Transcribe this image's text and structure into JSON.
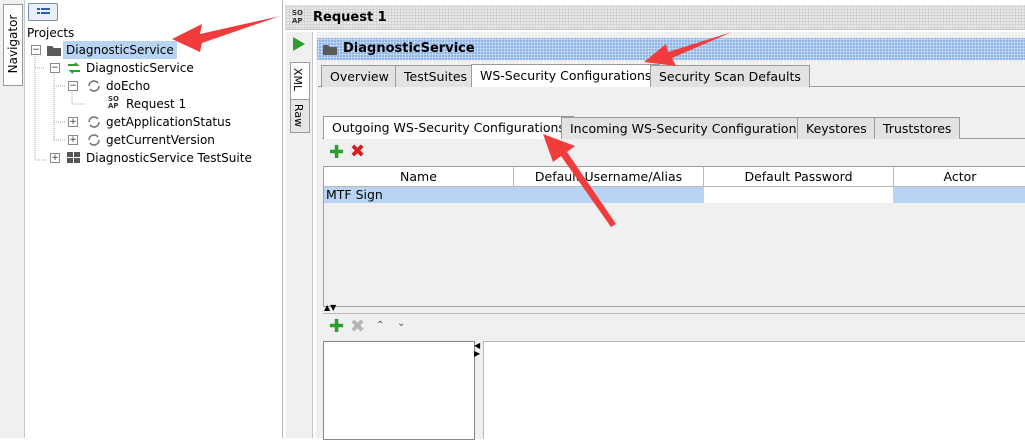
{
  "navigator": {
    "label": "Navigator"
  },
  "tree": {
    "root_label": "Projects",
    "items": [
      {
        "label": "DiagnosticService",
        "icon": "folder-icon",
        "selected": true
      },
      {
        "label": "DiagnosticService",
        "icon": "interface-icon"
      },
      {
        "label": "doEcho",
        "icon": "operation-icon"
      },
      {
        "label": "Request 1",
        "icon": "soap-request-icon"
      },
      {
        "label": "getApplicationStatus",
        "icon": "operation-icon"
      },
      {
        "label": "getCurrentVersion",
        "icon": "operation-icon"
      },
      {
        "label": "DiagnosticService TestSuite",
        "icon": "testsuite-icon"
      }
    ]
  },
  "request": {
    "badge": "SO AP",
    "title": "Request 1"
  },
  "editor_tabs": {
    "xml": "XML",
    "raw": "Raw"
  },
  "project": {
    "title": "DiagnosticService"
  },
  "main_tabs": [
    "Overview",
    "TestSuites",
    "WS-Security Configurations",
    "Security Scan Defaults"
  ],
  "sub_tabs": [
    "Outgoing WS-Security Configurations",
    "Incoming WS-Security Configurations",
    "Keystores",
    "Truststores"
  ],
  "grid": {
    "columns": [
      "Name",
      "Default Username/Alias",
      "Default Password",
      "Actor"
    ],
    "rows": [
      [
        "MTF Sign",
        "",
        "",
        ""
      ]
    ]
  },
  "colors": {
    "selection": "#b9d4f2",
    "add": "#2e9e2e",
    "remove": "#d21f1f",
    "header_blue": "#8fb6e6",
    "annotation": "#f03c3c"
  }
}
